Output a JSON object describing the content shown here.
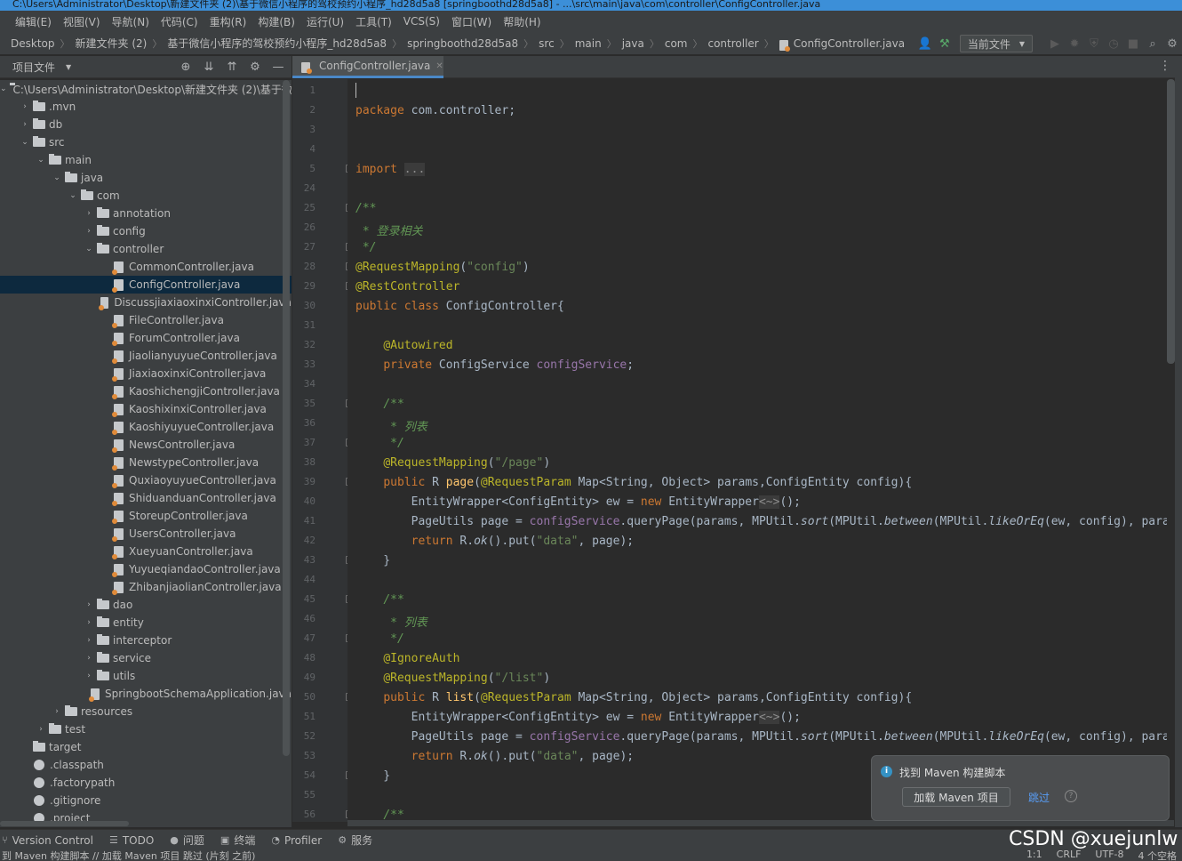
{
  "window": {
    "title": "C:\\Users\\Administrator\\Desktop\\新建文件夹 (2)\\基于微信小程序的驾校预约小程序_hd28d5a8 [springboothd28d5a8] - ...\\src\\main\\java\\com\\controller\\ConfigController.java"
  },
  "menu": [
    "编辑(E)",
    "视图(V)",
    "导航(N)",
    "代码(C)",
    "重构(R)",
    "构建(B)",
    "运行(U)",
    "工具(T)",
    "VCS(S)",
    "窗口(W)",
    "帮助(H)"
  ],
  "breadcrumbs": [
    "Desktop",
    "新建文件夹 (2)",
    "基于微信小程序的驾校预约小程序_hd28d5a8",
    "springboothd28d5a8",
    "src",
    "main",
    "java",
    "com",
    "controller",
    "ConfigController.java"
  ],
  "run_config": "当前文件",
  "project_panel": {
    "title": "项目文件",
    "tree": [
      {
        "label": "C:\\Users\\Administrator\\Desktop\\新建文件夹 (2)\\基于微",
        "depth": 0,
        "kind": "folder",
        "open": true
      },
      {
        "label": ".mvn",
        "depth": 1,
        "kind": "folder",
        "open": false
      },
      {
        "label": "db",
        "depth": 1,
        "kind": "folder",
        "open": false
      },
      {
        "label": "src",
        "depth": 1,
        "kind": "folder",
        "open": true
      },
      {
        "label": "main",
        "depth": 2,
        "kind": "folder",
        "open": true
      },
      {
        "label": "java",
        "depth": 3,
        "kind": "folder",
        "open": true
      },
      {
        "label": "com",
        "depth": 4,
        "kind": "folder",
        "open": true
      },
      {
        "label": "annotation",
        "depth": 5,
        "kind": "folder",
        "open": false
      },
      {
        "label": "config",
        "depth": 5,
        "kind": "folder",
        "open": false
      },
      {
        "label": "controller",
        "depth": 5,
        "kind": "folder",
        "open": true
      },
      {
        "label": "CommonController.java",
        "depth": 6,
        "kind": "java"
      },
      {
        "label": "ConfigController.java",
        "depth": 6,
        "kind": "java",
        "selected": true
      },
      {
        "label": "DiscussjiaxiaoxinxiController.java",
        "depth": 6,
        "kind": "java"
      },
      {
        "label": "FileController.java",
        "depth": 6,
        "kind": "java"
      },
      {
        "label": "ForumController.java",
        "depth": 6,
        "kind": "java"
      },
      {
        "label": "JiaolianyuyueController.java",
        "depth": 6,
        "kind": "java"
      },
      {
        "label": "JiaxiaoxinxiController.java",
        "depth": 6,
        "kind": "java"
      },
      {
        "label": "KaoshichengjiController.java",
        "depth": 6,
        "kind": "java"
      },
      {
        "label": "KaoshixinxiController.java",
        "depth": 6,
        "kind": "java"
      },
      {
        "label": "KaoshiyuyueController.java",
        "depth": 6,
        "kind": "java"
      },
      {
        "label": "NewsController.java",
        "depth": 6,
        "kind": "java"
      },
      {
        "label": "NewstypeController.java",
        "depth": 6,
        "kind": "java"
      },
      {
        "label": "QuxiaoyuyueController.java",
        "depth": 6,
        "kind": "java"
      },
      {
        "label": "ShiduanduanController.java",
        "depth": 6,
        "kind": "java"
      },
      {
        "label": "StoreupController.java",
        "depth": 6,
        "kind": "java"
      },
      {
        "label": "UsersController.java",
        "depth": 6,
        "kind": "java"
      },
      {
        "label": "XueyuanController.java",
        "depth": 6,
        "kind": "java"
      },
      {
        "label": "YuyueqiandaoController.java",
        "depth": 6,
        "kind": "java"
      },
      {
        "label": "ZhibanjiaolianController.java",
        "depth": 6,
        "kind": "java"
      },
      {
        "label": "dao",
        "depth": 5,
        "kind": "folder",
        "open": false
      },
      {
        "label": "entity",
        "depth": 5,
        "kind": "folder",
        "open": false
      },
      {
        "label": "interceptor",
        "depth": 5,
        "kind": "folder",
        "open": false
      },
      {
        "label": "service",
        "depth": 5,
        "kind": "folder",
        "open": false
      },
      {
        "label": "utils",
        "depth": 5,
        "kind": "folder",
        "open": false
      },
      {
        "label": "SpringbootSchemaApplication.java",
        "depth": 5,
        "kind": "java"
      },
      {
        "label": "resources",
        "depth": 3,
        "kind": "folder",
        "open": false
      },
      {
        "label": "test",
        "depth": 2,
        "kind": "folder",
        "open": false
      },
      {
        "label": "target",
        "depth": 1,
        "kind": "folder-plain"
      },
      {
        "label": ".classpath",
        "depth": 1,
        "kind": "dot"
      },
      {
        "label": ".factorypath",
        "depth": 1,
        "kind": "dot"
      },
      {
        "label": ".gitignore",
        "depth": 1,
        "kind": "dot"
      },
      {
        "label": ".project",
        "depth": 1,
        "kind": "dot"
      }
    ]
  },
  "editor": {
    "tab": "ConfigController.java",
    "lines": [
      {
        "n": "1",
        "html": ""
      },
      {
        "n": "2",
        "html": "<span class=\"kw\">package</span> com.controller;"
      },
      {
        "n": "3",
        "html": ""
      },
      {
        "n": "4",
        "html": ""
      },
      {
        "n": "5",
        "html": "<span class=\"kw\">import</span> <span class=\"mute\">...</span>"
      },
      {
        "n": "24",
        "html": ""
      },
      {
        "n": "25",
        "html": "<span class=\"cm\">/**</span>"
      },
      {
        "n": "26",
        "html": "<span class=\"cm\"> * 登录相关</span>"
      },
      {
        "n": "27",
        "html": "<span class=\"cm\"> */</span>"
      },
      {
        "n": "28",
        "html": "<span class=\"an\">@RequestMapping</span>(<span class=\"st\">\"config\"</span>)"
      },
      {
        "n": "29",
        "html": "<span class=\"an\">@RestController</span>"
      },
      {
        "n": "30",
        "html": "<span class=\"kw\">public class</span> ConfigController{"
      },
      {
        "n": "31",
        "html": ""
      },
      {
        "n": "32",
        "html": "    <span class=\"an\">@Autowired</span>"
      },
      {
        "n": "33",
        "html": "    <span class=\"kw\">private</span> ConfigService <span class=\"fd\">configService</span>;"
      },
      {
        "n": "34",
        "html": ""
      },
      {
        "n": "35",
        "html": "    <span class=\"cm\">/**</span>"
      },
      {
        "n": "36",
        "html": "<span class=\"cm\">     * 列表</span>"
      },
      {
        "n": "37",
        "html": "<span class=\"cm\">     */</span>"
      },
      {
        "n": "38",
        "html": "    <span class=\"an\">@RequestMapping</span>(<span class=\"st\">\"/page\"</span>)"
      },
      {
        "n": "39",
        "html": "    <span class=\"kw\">public</span> R <span class=\"fn\">page</span>(<span class=\"an\">@RequestParam</span> Map&lt;String, Object&gt; params,ConfigEntity config){"
      },
      {
        "n": "40",
        "html": "        EntityWrapper&lt;ConfigEntity&gt; ew = <span class=\"kw\">new</span> EntityWrapper<span class=\"mute\">&lt;~&gt;</span>();"
      },
      {
        "n": "41",
        "html": "        PageUtils page = <span class=\"fd\">configService</span>.queryPage(params, MPUtil.<i>sort</i>(MPUtil.<i>between</i>(MPUtil.<i>likeOrEq</i>(ew, config), params), params));"
      },
      {
        "n": "42",
        "html": "        <span class=\"kw\">return</span> R.<i>ok</i>().put(<span class=\"st\">\"data\"</span>, page);"
      },
      {
        "n": "43",
        "html": "    }"
      },
      {
        "n": "44",
        "html": ""
      },
      {
        "n": "45",
        "html": "    <span class=\"cm\">/**</span>"
      },
      {
        "n": "46",
        "html": "<span class=\"cm\">     * 列表</span>"
      },
      {
        "n": "47",
        "html": "<span class=\"cm\">     */</span>"
      },
      {
        "n": "48",
        "html": "    <span class=\"an\">@IgnoreAuth</span>"
      },
      {
        "n": "49",
        "html": "    <span class=\"an\">@RequestMapping</span>(<span class=\"st\">\"/list\"</span>)"
      },
      {
        "n": "50",
        "html": "    <span class=\"kw\">public</span> R <span class=\"fn\">list</span>(<span class=\"an\">@RequestParam</span> Map&lt;String, Object&gt; params,ConfigEntity config){"
      },
      {
        "n": "51",
        "html": "        EntityWrapper&lt;ConfigEntity&gt; ew = <span class=\"kw\">new</span> EntityWrapper<span class=\"mute\">&lt;~&gt;</span>();"
      },
      {
        "n": "52",
        "html": "        PageUtils page = <span class=\"fd\">configService</span>.queryPage(params, MPUtil.<i>sort</i>(MPUtil.<i>between</i>(MPUtil.<i>likeOrEq</i>(ew, config), params), params));"
      },
      {
        "n": "53",
        "html": "        <span class=\"kw\">return</span> R.<i>ok</i>().put(<span class=\"st\">\"data\"</span>, page);"
      },
      {
        "n": "54",
        "html": "    }"
      },
      {
        "n": "55",
        "html": ""
      },
      {
        "n": "56",
        "html": "    <span class=\"cm\">/**</span>"
      }
    ]
  },
  "notification": {
    "message": "找到 Maven 构建脚本",
    "button": "加载 Maven 项目",
    "link": "跳过",
    "help": "?"
  },
  "tool_windows": [
    {
      "icon": "⑂",
      "label": "Version Control"
    },
    {
      "icon": "☰",
      "label": "TODO"
    },
    {
      "icon": "●",
      "label": "问题"
    },
    {
      "icon": "▣",
      "label": "终端"
    },
    {
      "icon": "◔",
      "label": "Profiler"
    },
    {
      "icon": "⚙",
      "label": "服务"
    }
  ],
  "status": {
    "message": "到 Maven 构建脚本 // 加载 Maven 项目    跳过 (片刻 之前)",
    "position": "1:1",
    "line_sep": "CRLF",
    "encoding": "UTF-8",
    "indent": "4 个空格"
  },
  "watermark": "CSDN @xuejunlw"
}
